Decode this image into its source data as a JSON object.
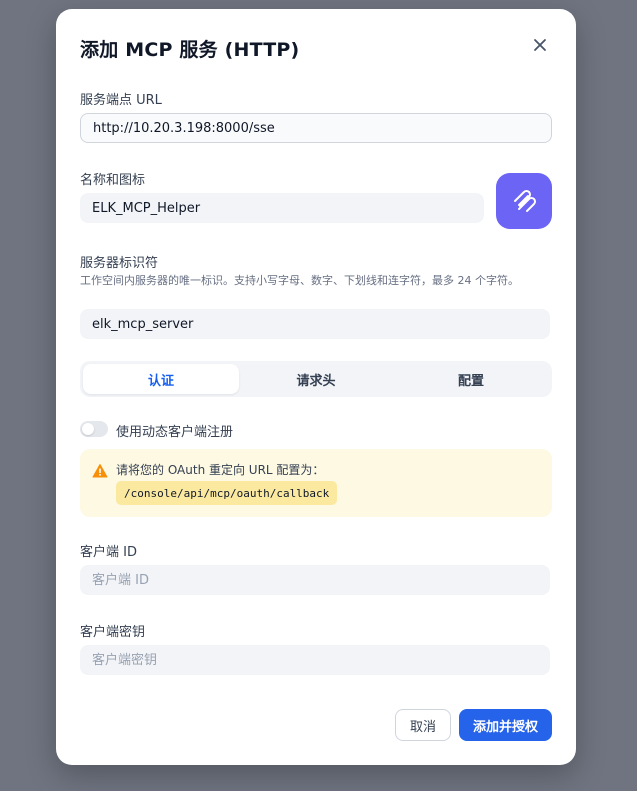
{
  "modal": {
    "title": "添加 MCP 服务 (HTTP)",
    "close_icon": "close-icon"
  },
  "endpoint": {
    "label": "服务端点 URL",
    "value": "http://10.20.3.198:8000/sse"
  },
  "name_icon": {
    "label": "名称和图标",
    "value": "ELK_MCP_Helper",
    "icon": "paperclip-icon",
    "icon_bg_color": "#6b64f5"
  },
  "server_id": {
    "label": "服务器标识符",
    "hint": "工作空间内服务器的唯一标识。支持小写字母、数字、下划线和连字符，最多 24 个字符。",
    "value": "elk_mcp_server"
  },
  "tabs": [
    {
      "label": "认证",
      "active": true
    },
    {
      "label": "请求头",
      "active": false
    },
    {
      "label": "配置",
      "active": false
    }
  ],
  "dynamic_registration": {
    "label": "使用动态客户端注册",
    "enabled": false
  },
  "warning": {
    "icon": "warning-triangle-icon",
    "text": "请将您的 OAuth 重定向 URL 配置为：",
    "code": "/console/api/mcp/oauth/callback"
  },
  "client_id": {
    "label": "客户端 ID",
    "placeholder": "客户端 ID"
  },
  "client_secret": {
    "label": "客户端密钥",
    "placeholder": "客户端密钥"
  },
  "footer": {
    "cancel_label": "取消",
    "submit_label": "添加并授权"
  },
  "colors": {
    "primary": "#2563eb",
    "active_tab_text": "#155eef",
    "warning": "#f79009"
  }
}
